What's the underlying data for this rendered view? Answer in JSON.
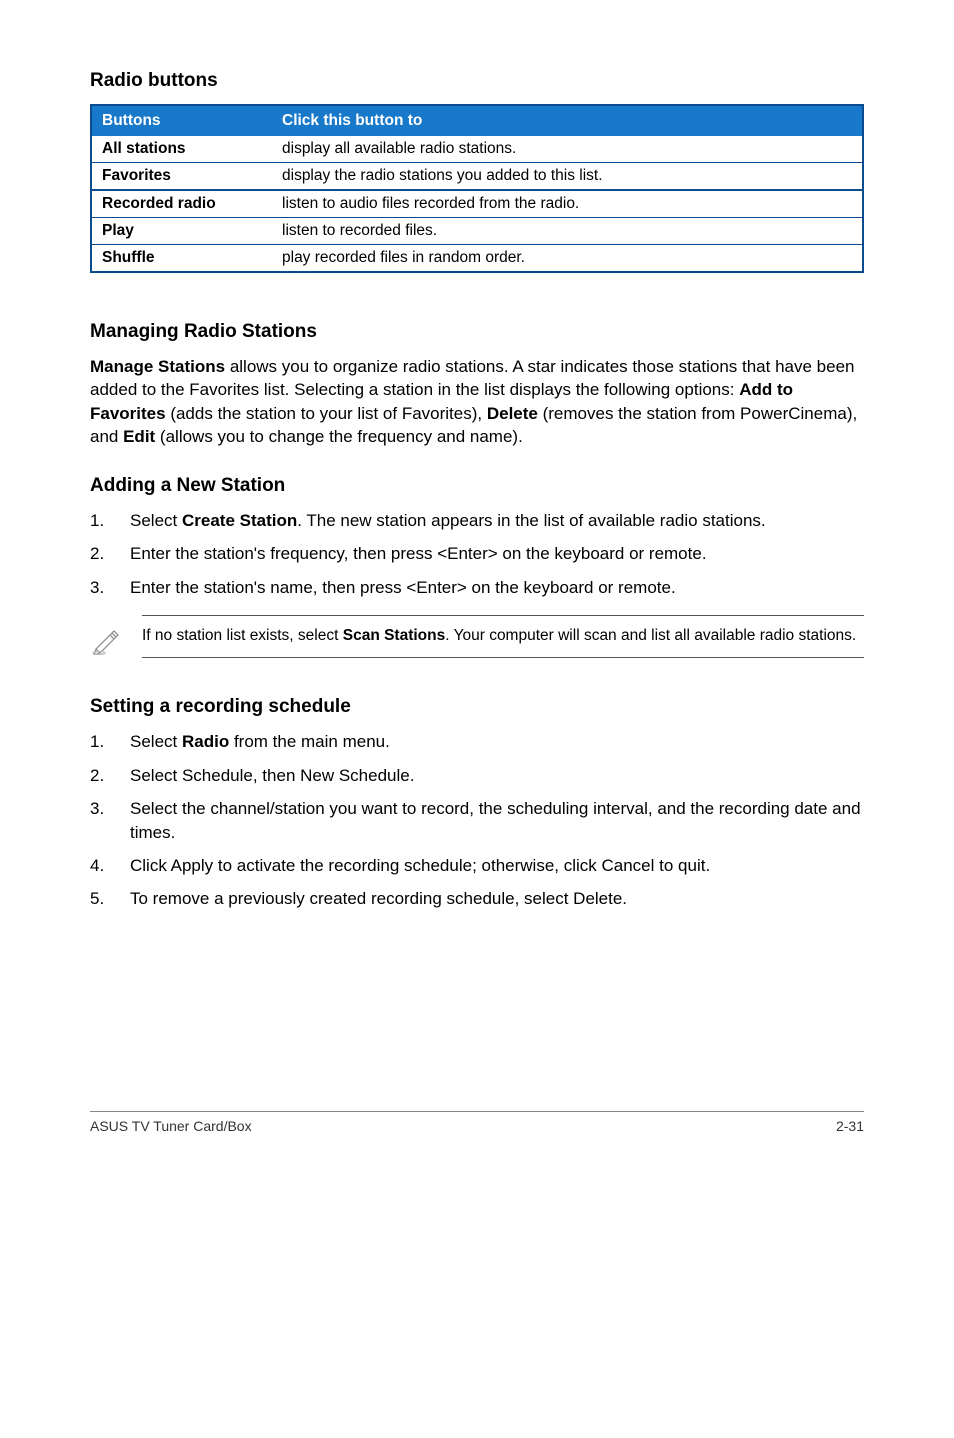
{
  "headings": {
    "radio_buttons": "Radio buttons",
    "managing": "Managing Radio Stations",
    "adding": "Adding a New Station",
    "schedule": "Setting a recording schedule"
  },
  "table": {
    "header_buttons": "Buttons",
    "header_click": "Click this button to",
    "rows": [
      {
        "label": "All stations",
        "desc": "display all available radio stations."
      },
      {
        "label": "Favorites",
        "desc": "display the radio stations you added to this list."
      },
      {
        "label": "Recorded radio",
        "desc": "listen to audio files recorded from the radio."
      },
      {
        "label": "Play",
        "desc": "listen to recorded files."
      },
      {
        "label": "Shuffle",
        "desc": "play recorded files in random order."
      }
    ]
  },
  "managing_text": {
    "p1a": "Manage Stations",
    "p1b": " allows you to organize radio stations. A star indicates those stations that have been added to the Favorites list. Selecting a station in the list displays the following options: ",
    "p1c": "Add to Favorites",
    "p1d": " (adds the station to your list of Favorites), ",
    "p1e": "Delete",
    "p1f": " (removes the station from PowerCinema), and ",
    "p1g": "Edit",
    "p1h": " (allows you to change the frequency and name)."
  },
  "adding_steps": {
    "n1": "1.",
    "t1a": "Select ",
    "t1b": "Create Station",
    "t1c": ". The new station appears in the list of available radio stations.",
    "n2": "2.",
    "t2": "Enter the station's frequency, then press <Enter> on the keyboard or remote.",
    "n3": "3.",
    "t3": "Enter the station's name, then press <Enter> on the keyboard or remote."
  },
  "note": {
    "a": "If no station list exists, select ",
    "b": "Scan Stations",
    "c": ". Your computer will scan and list all available radio stations."
  },
  "schedule_steps": {
    "n1": "1.",
    "t1a": "Select ",
    "t1b": "Radio",
    "t1c": " from the main menu.",
    "n2": "2.",
    "t2": "Select Schedule, then New Schedule.",
    "n3": "3.",
    "t3": "Select the channel/station you want to record, the scheduling interval, and the recording date and times.",
    "n4": "4.",
    "t4": "Click Apply to activate the recording schedule; otherwise, click Cancel to quit.",
    "n5": "5.",
    "t5": "To remove a previously created recording schedule, select Delete."
  },
  "footer": {
    "left": "ASUS TV Tuner Card/Box",
    "right": "2-31"
  }
}
